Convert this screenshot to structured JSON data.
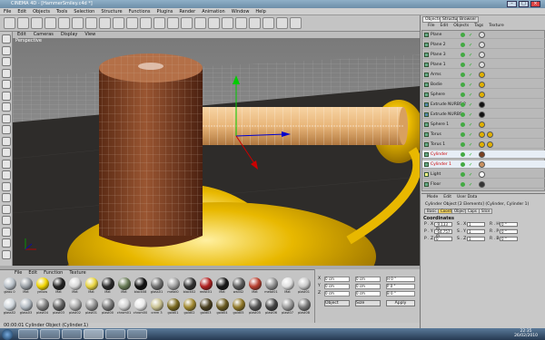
{
  "app": {
    "title": "CINEMA 4D - [HammerSmiley.c4d *]",
    "menu": [
      "File",
      "Edit",
      "Objects",
      "Tools",
      "Selection",
      "Structure",
      "Functions",
      "Plugins",
      "Render",
      "Animation",
      "Window",
      "Help"
    ]
  },
  "viewport": {
    "menu": [
      "Edit",
      "Cameras",
      "Display",
      "View"
    ],
    "label": "Perspective",
    "colors": {
      "floor": "#2e2c2a",
      "sky": "#8a8a8a",
      "handle": "#e8b578",
      "head": "#8a4a2a",
      "smiley": "#e8b400"
    }
  },
  "materials": {
    "menu": [
      "File",
      "Edit",
      "Function",
      "Texture"
    ],
    "row1": [
      {
        "label": "glass 0",
        "color": "#b8c0c8"
      },
      {
        "label": "Mat",
        "color": "#9aa0a6"
      },
      {
        "label": "yellow",
        "color": "#f0d400"
      },
      {
        "label": "Mat",
        "color": "#222"
      },
      {
        "label": "Mat",
        "color": "#d8d8d8"
      },
      {
        "label": "Mat",
        "color": "#e8d440"
      },
      {
        "label": "Mat",
        "color": "#2a2a2a"
      },
      {
        "label": "Mat",
        "color": "#6a7c58"
      },
      {
        "label": "black08",
        "color": "#111"
      },
      {
        "label": "glass01",
        "color": "#707070"
      },
      {
        "label": "metal0",
        "color": "#a0a0a0"
      },
      {
        "label": "black02",
        "color": "#333"
      },
      {
        "label": "redst01",
        "color": "#b02020"
      },
      {
        "label": "Mat",
        "color": "#181818"
      },
      {
        "label": "wall42",
        "color": "#5a5a5a"
      },
      {
        "label": "Mat",
        "color": "#b84030"
      },
      {
        "label": "metal01",
        "color": "#909090"
      },
      {
        "label": "Mat",
        "color": "#e0e0e0"
      },
      {
        "label": "plast01",
        "color": "#c8c8c8"
      }
    ],
    "row2": [
      {
        "label": "glass02",
        "color": "#cfd6dc"
      },
      {
        "label": "glass03",
        "color": "#b0b8c0"
      },
      {
        "label": "plast04",
        "color": "#808080"
      },
      {
        "label": "plast03",
        "color": "#606060"
      },
      {
        "label": "plast02",
        "color": "#a8a8a8"
      },
      {
        "label": "plast01",
        "color": "#909090"
      },
      {
        "label": "plast00",
        "color": "#787878"
      },
      {
        "label": "chrom01",
        "color": "#d0d0d0"
      },
      {
        "label": "chrom00",
        "color": "#e8e8e8"
      },
      {
        "label": "crem 3",
        "color": "#c8c090"
      },
      {
        "label": "gold01",
        "color": "#7a6a20"
      },
      {
        "label": "gold02",
        "color": "#a08830"
      },
      {
        "label": "gold03",
        "color": "#4a4020"
      },
      {
        "label": "gold04",
        "color": "#6a5a20"
      },
      {
        "label": "gold05",
        "color": "#907828"
      },
      {
        "label": "plast05",
        "color": "#555"
      },
      {
        "label": "plast06",
        "color": "#444"
      },
      {
        "label": "plast07",
        "color": "#999"
      },
      {
        "label": "plast08",
        "color": "#777"
      }
    ]
  },
  "coords": {
    "labels": [
      "Object",
      "Size",
      "Apply"
    ],
    "rows": [
      {
        "axis": "X",
        "pos": "0 cm",
        "size": "0 cm",
        "rot": "H 0 °"
      },
      {
        "axis": "Y",
        "pos": "0 cm",
        "size": "0 cm",
        "rot": "P 0 °"
      },
      {
        "axis": "Z",
        "pos": "0 cm",
        "size": "0 cm",
        "rot": "B 0 °"
      }
    ]
  },
  "status": "00:00:01  Cylinder Object (Cylinder.1)",
  "objects": {
    "tabs": [
      "Objects",
      "Structure",
      "Browser"
    ],
    "menu": [
      "File",
      "Edit",
      "Objects",
      "Tags",
      "Texture"
    ],
    "rows": [
      {
        "name": "Plane",
        "tag": "#ddd"
      },
      {
        "name": "Plane 2",
        "tag": "#ddd"
      },
      {
        "name": "Plane 3",
        "tag": "#ddd"
      },
      {
        "name": "Plane 1",
        "tag": "#ddd"
      },
      {
        "name": "Arms",
        "tag": "#e0b000"
      },
      {
        "name": "Bodie",
        "tag": "#e0b000"
      },
      {
        "name": "Sphere",
        "tag": "#e0b000"
      },
      {
        "name": "Extrude NURBS 2",
        "tag": "#111"
      },
      {
        "name": "Extrude NURBS",
        "tag": "#111"
      },
      {
        "name": "Sphere 1",
        "tag": "#e0b000"
      },
      {
        "name": "Torus",
        "tag": "#e0b000"
      },
      {
        "name": "Torus 1",
        "tag": "#e0b000"
      },
      {
        "name": "Cylinder",
        "tag": "#7a4020"
      },
      {
        "name": "Cylinder 1",
        "tag": "#c89060"
      },
      {
        "name": "Light",
        "tag": "#fff"
      },
      {
        "name": "Floor",
        "tag": "#333"
      }
    ]
  },
  "attributes": {
    "menu": [
      "Mode",
      "Edit",
      "User Data"
    ],
    "title": "Cylinder Object [2 Elements] (Cylinder, Cylinder 1)",
    "tabs": [
      "Basic",
      "Coord.",
      "Object",
      "Caps",
      "Slice"
    ],
    "section": "Coordinates",
    "rows": [
      {
        "a": "P . X",
        "va": "-9.133 m",
        "b": "S . X",
        "vb": "1",
        "c": "R . H",
        "vc": "0 °"
      },
      {
        "a": "P . Y",
        "va": "-64.757 m",
        "b": "S . Y",
        "vb": "1",
        "c": "R . P",
        "vc": "0 °"
      },
      {
        "a": "P . Z",
        "va": "0",
        "b": "S . Z",
        "vb": "1",
        "c": "R . B",
        "vc": "0 °"
      }
    ]
  },
  "taskbar": {
    "clock_time": "22:35",
    "clock_date": "26/02/2010"
  }
}
